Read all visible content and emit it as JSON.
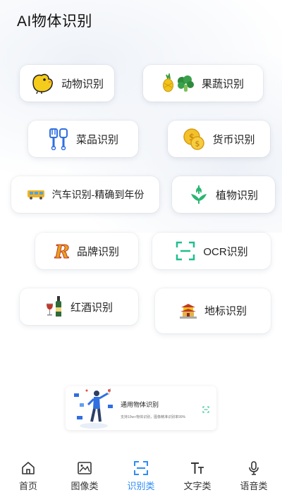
{
  "header": {
    "title": "AI物体识别"
  },
  "categories": [
    {
      "label": "动物识别",
      "icon": "chick-icon"
    },
    {
      "label": "果蔬识别",
      "icon": "fruit-vegetable-icon"
    },
    {
      "label": "菜品识别",
      "icon": "utensils-icon"
    },
    {
      "label": "货币识别",
      "icon": "coins-icon"
    },
    {
      "label": "汽车识别-精确到年份",
      "icon": "bus-icon"
    },
    {
      "label": "植物识别",
      "icon": "plant-icon"
    },
    {
      "label": "品牌识别",
      "icon": "brand-logo-icon"
    },
    {
      "label": "OCR识别",
      "icon": "ocr-scan-icon"
    },
    {
      "label": "红酒识别",
      "icon": "wine-icon"
    },
    {
      "label": "地标识别",
      "icon": "landmark-icon"
    }
  ],
  "banner": {
    "title": "通用物体识别",
    "subtitle": "支持10w+物体识别，图像精准识别率99%"
  },
  "tabs": [
    {
      "label": "首页",
      "icon": "home-icon",
      "active": false
    },
    {
      "label": "图像类",
      "icon": "image-icon",
      "active": false
    },
    {
      "label": "识别类",
      "icon": "scan-icon",
      "active": true
    },
    {
      "label": "文字类",
      "icon": "text-icon",
      "active": false
    },
    {
      "label": "语音类",
      "icon": "microphone-icon",
      "active": false
    }
  ],
  "colors": {
    "accent": "#2f8cf6",
    "ocr_green": "#1fbf8f",
    "plant_green": "#2bb673"
  }
}
